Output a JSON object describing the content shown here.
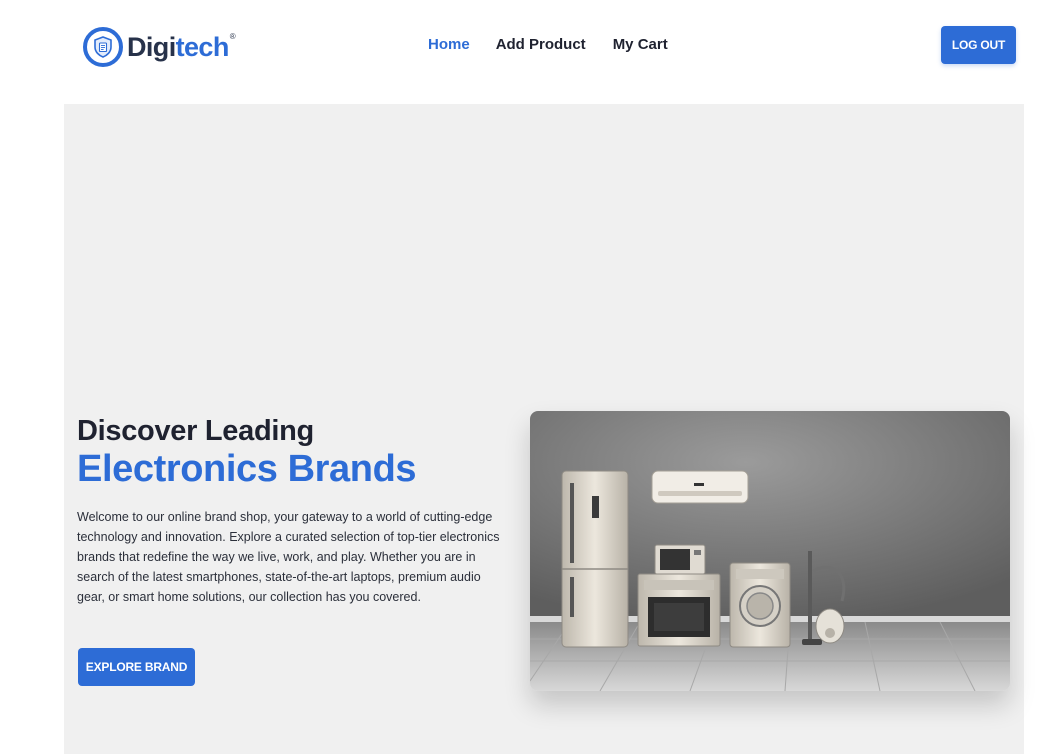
{
  "header": {
    "logo": {
      "text_main": "Digi",
      "text_accent": "tech",
      "registered_mark": "®",
      "icon": "shield-document-icon"
    },
    "nav": [
      {
        "label": "Home",
        "active": true
      },
      {
        "label": "Add Product",
        "active": false
      },
      {
        "label": "My Cart",
        "active": false
      }
    ],
    "logout_label": "LOG OUT"
  },
  "hero": {
    "title_line1": "Discover Leading",
    "title_line2": "Electronics Brands",
    "description": "Welcome to our online brand shop, your gateway to a world of cutting-edge technology and innovation. Explore a curated selection of top-tier electronics brands that redefine the way we live, work, and play. Whether you are in search of the latest smartphones, state-of-the-art laptops, premium audio gear, or smart home solutions, our collection has you covered.",
    "button_label": "EXPLORE BRAND",
    "image": {
      "icon": "home-appliances-image"
    }
  },
  "colors": {
    "accent": "#2d6cd6",
    "text_dark": "#1f2230",
    "hero_bg": "#f0f0f0"
  }
}
